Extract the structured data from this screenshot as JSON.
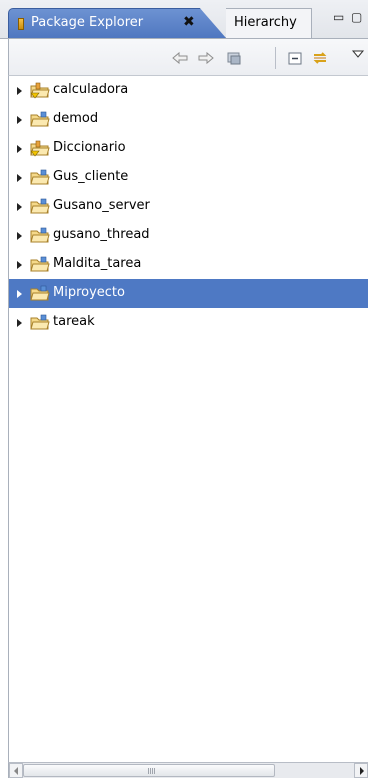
{
  "tabs": {
    "active_label": "Package Explorer",
    "close_glyph": "✖",
    "inactive_label": "Hierarchy"
  },
  "window_controls": {
    "minimize": "▭",
    "maximize": "▢"
  },
  "toolbar": {
    "buttons": [
      "back-icon",
      "forward-icon",
      "go-into-icon",
      "collapse-all-icon",
      "link-with-editor-icon",
      "view-menu-icon"
    ]
  },
  "tree": {
    "items": [
      {
        "label": "calculadora",
        "icon": "java-project-warning-icon",
        "selected": false
      },
      {
        "label": "demod",
        "icon": "java-project-icon",
        "selected": false
      },
      {
        "label": "Diccionario",
        "icon": "java-project-warning-icon",
        "selected": false
      },
      {
        "label": "Gus_cliente",
        "icon": "java-project-icon",
        "selected": false
      },
      {
        "label": "Gusano_server",
        "icon": "java-project-icon",
        "selected": false
      },
      {
        "label": "gusano_thread",
        "icon": "java-project-icon",
        "selected": false
      },
      {
        "label": "Maldita_tarea",
        "icon": "java-project-icon",
        "selected": false
      },
      {
        "label": "Miproyecto",
        "icon": "java-project-icon",
        "selected": true
      },
      {
        "label": "tareak",
        "icon": "java-project-icon",
        "selected": false
      }
    ]
  },
  "colors": {
    "selection": "#4e79c4",
    "active_tab": "#5b82c8"
  }
}
